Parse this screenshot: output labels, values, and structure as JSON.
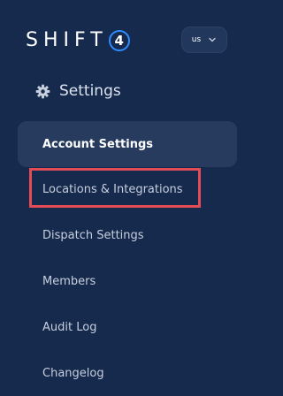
{
  "brand": {
    "name": "SHIFT",
    "badge": "4"
  },
  "locale": {
    "label": "us",
    "icon": "chevron-down-icon"
  },
  "section": {
    "icon": "gear-icon",
    "title": "Settings"
  },
  "nav": {
    "items": [
      {
        "label": "Account Settings",
        "active": true
      },
      {
        "label": "Locations & Integrations",
        "active": false,
        "highlighted": true
      },
      {
        "label": "Dispatch Settings",
        "active": false
      },
      {
        "label": "Members",
        "active": false
      },
      {
        "label": "Audit Log",
        "active": false
      },
      {
        "label": "Changelog",
        "active": false
      }
    ]
  },
  "colors": {
    "background": "#152a4d",
    "active_item": "#263b5e",
    "brand_accent": "#2f8cff",
    "highlight": "#e34b55"
  }
}
